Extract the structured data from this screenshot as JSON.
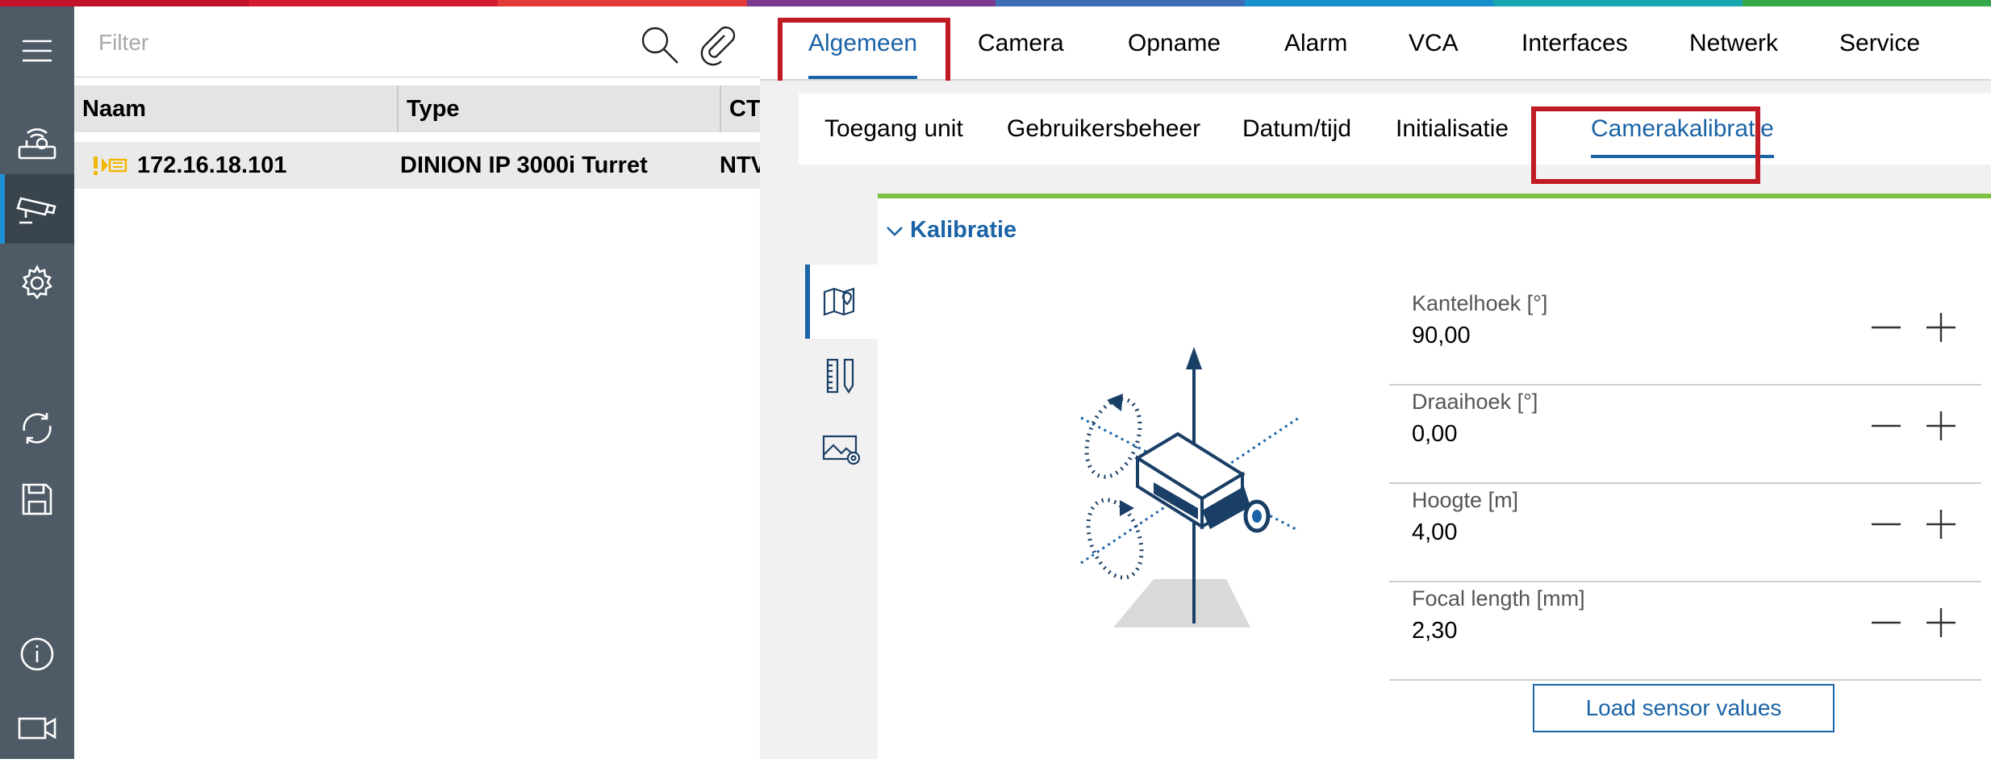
{
  "brand_colors": [
    "#c2132a",
    "#d61a31",
    "#e23a3a",
    "#7a3a8e",
    "#3e6fb5",
    "#1a8fce",
    "#17a7b0",
    "#38a94b"
  ],
  "sidebar": {
    "items": [
      {
        "icon": "menu-icon"
      },
      {
        "icon": "network-devices-icon"
      },
      {
        "icon": "camera-icon",
        "active": true
      },
      {
        "icon": "settings-gear-icon"
      },
      {
        "icon": "refresh-icon"
      },
      {
        "icon": "save-icon"
      },
      {
        "icon": "info-icon"
      },
      {
        "icon": "video-icon"
      }
    ]
  },
  "filter": {
    "placeholder": "Filter"
  },
  "device_table": {
    "columns": [
      "Naam",
      "Type",
      "CTI"
    ],
    "rows": [
      {
        "name": "172.16.18.101",
        "type": "DINION IP 3000i Turret",
        "cti": "NTV",
        "status_icon": "warning-device-icon"
      }
    ]
  },
  "main_tabs": [
    "Algemeen",
    "Camera",
    "Opname",
    "Alarm",
    "VCA",
    "Interfaces",
    "Netwerk",
    "Service"
  ],
  "main_tab_active": "Algemeen",
  "sub_tabs": [
    "Toegang unit",
    "Gebruikersbeheer",
    "Datum/tijd",
    "Initialisatie",
    "Camerakalibratie"
  ],
  "sub_tab_active": "Camerakalibratie",
  "calibration": {
    "section_title": "Kalibratie",
    "side_tabs": [
      "map-pin-icon",
      "ruler-pencil-icon",
      "image-settings-icon"
    ],
    "fields": [
      {
        "label": "Kantelhoek [°]",
        "value": "90,00"
      },
      {
        "label": "Draaihoek [°]",
        "value": "0,00"
      },
      {
        "label": "Hoogte [m]",
        "value": "4,00"
      },
      {
        "label": "Focal length [mm]",
        "value": "2,30"
      }
    ],
    "load_button": "Load sensor values"
  },
  "colors": {
    "accent": "#1a63a6",
    "highlight": "#c01a24",
    "card_top": "#7dc242",
    "rail": "#4e5a65"
  }
}
